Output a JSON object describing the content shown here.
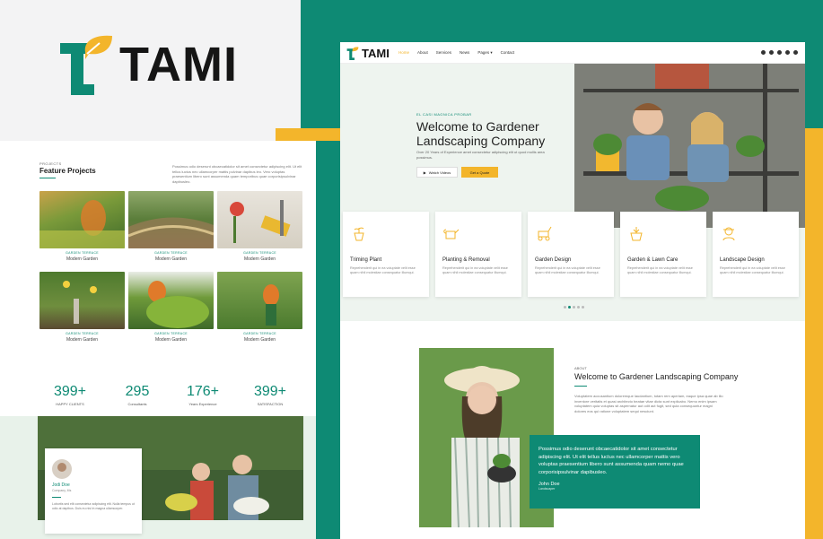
{
  "brand": {
    "name": "TAMI",
    "colors": {
      "teal": "#0e8a74",
      "yellow": "#f3b52b",
      "leaf": "#f3b52b"
    }
  },
  "projects": {
    "eyebrow": "PROJECTS",
    "title": "Feature Projects",
    "description": "Possimus odio deserunt obcaecatidolor sit amet consectetur adipiscing elit. Ut elit tellus luctus nec ullamcorper mattis pulvinar dapibus leo. Vero voluptas praesentium libero sunt assumenda quam temporibus quae corporisipsulvinar dapibusleo.",
    "items": [
      {
        "tag": "GARDEN TERRACE",
        "name": "Modern Garden"
      },
      {
        "tag": "GARDEN TERRACE",
        "name": "Modern Garden"
      },
      {
        "tag": "GARDEN TERRACE",
        "name": "Modern Garden"
      },
      {
        "tag": "GARDEN TERRACE",
        "name": "Modern Garden"
      },
      {
        "tag": "GARDEN TERRACE",
        "name": "Modern Garden"
      },
      {
        "tag": "GARDEN TERRACE",
        "name": "Modern Garden"
      }
    ]
  },
  "stats": [
    {
      "value": "399+",
      "label": "HAPPY CLIENTS"
    },
    {
      "value": "295",
      "label": "Consultants"
    },
    {
      "value": "176+",
      "label": "Years Experience"
    },
    {
      "value": "399+",
      "label": "SATISFACTION"
    }
  ],
  "testimonial_card": {
    "name": "Jodi Doe",
    "role": "Company, Ms",
    "text": "Lobortis sed elit consectetur adipiscing elit. Nulla tempus ut odio at dapibus. Duis eu nisi in magna ullamcorper."
  },
  "nav": {
    "logo": "TAMI",
    "links": [
      "Home",
      "About",
      "Services",
      "News",
      "Pages",
      "Contact"
    ],
    "pages_caret": "▾",
    "socials": [
      "facebook-icon",
      "twitter-icon",
      "youtube-icon",
      "instagram-icon",
      "search-icon"
    ]
  },
  "hero": {
    "eyebrow": "EL CASI MAGNICA PROBAR",
    "title": "Welcome to Gardener Landscaping Company",
    "subtitle": "Over 20 Years of Experience amet consectetur adipiscing elit ut quod mollis area possimus.",
    "watch_label": "Watch Videos",
    "quote_label": "Get a Quote"
  },
  "services": [
    {
      "icon": "planter-icon",
      "title": "Triming Plant",
      "text": "Reprehenderit qui in ea voluptate velit esse quam nihil molestiae consequatur illumqui."
    },
    {
      "icon": "watering-can-icon",
      "title": "Planting & Removal",
      "text": "Reprehenderit qui in ea voluptate velit esse quam nihil molestiae consequatur illumqui."
    },
    {
      "icon": "lawn-mower-icon",
      "title": "Garden Design",
      "text": "Reprehenderit qui in ea voluptate velit esse quam nihil molestiae consequatur illumqui."
    },
    {
      "icon": "plant-pot-icon",
      "title": "Garden & Lawn Care",
      "text": "Reprehenderit qui in ea voluptate velit esse quam nihil molestiae consequatur illumqui."
    },
    {
      "icon": "gardener-icon",
      "title": "Landscape Design",
      "text": "Reprehenderit qui in ea voluptate velit esse quam nihil molestiae consequatur illumqui."
    }
  ],
  "about": {
    "eyebrow": "ABOUT",
    "title": "Welcome to Gardener Landscaping Company",
    "text": "Voluptatem accusantium doloremque laudantium, totam rem aperiam, eaque ipsa quae ab illo inventore veritatis et quasi architecto beatae vitae dicta sunt explicabo. Nemo enim ipsam voluptatem quia voluptas sit aspernatur aut odit aut fugit, sed quia consequuntur magni dolores eos qui ratione voluptatem sequi nesciunt.",
    "quote": "Possimus odio deserunt obcaecatidolor sit amet consectetur adipiscing elit. Ut elit tellus luctus nec ullamcorper mattis vero voluptas praesentium libero sunt assumenda quam nemo quae corporisipsulvinar dapibusleo.",
    "author": "John Doe",
    "role": "Landscaper"
  }
}
